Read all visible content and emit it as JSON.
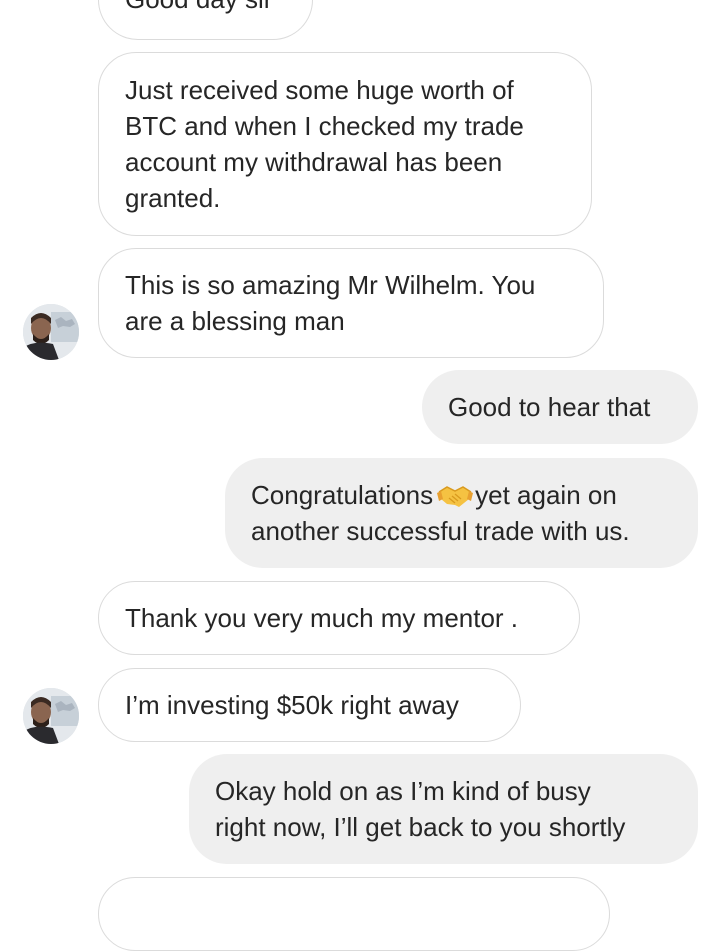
{
  "conversation": {
    "messages": [
      {
        "direction": "incoming",
        "lines": [
          "Good day sir"
        ]
      },
      {
        "direction": "incoming",
        "lines": [
          "Just received some huge worth of",
          "BTC and when I checked my trade",
          "account my withdrawal has been",
          "granted."
        ]
      },
      {
        "direction": "incoming",
        "lines": [
          "This is so amazing Mr Wilhelm. You",
          "are a blessing man"
        ]
      },
      {
        "direction": "outgoing",
        "lines": [
          "Good to hear that"
        ]
      },
      {
        "direction": "outgoing",
        "lines": [
          "Congratulations",
          "yet again on",
          "another successful trade with us."
        ]
      },
      {
        "direction": "incoming",
        "lines": [
          "Thank you very much my mentor ."
        ]
      },
      {
        "direction": "incoming",
        "lines": [
          "I’m investing $50k right away"
        ]
      },
      {
        "direction": "outgoing",
        "lines": [
          "Okay hold on as I’m kind of busy",
          "right now, I’ll get back to you shortly"
        ]
      },
      {
        "direction": "incoming",
        "lines": []
      }
    ],
    "icons": {
      "congrats_emoji": "handshake-icon",
      "sender_avatar": "avatar"
    }
  },
  "colors": {
    "incoming_bubble_bg": "#ffffff",
    "incoming_bubble_border": "#dbdbdb",
    "outgoing_bubble_bg": "#efefef",
    "text": "#262626"
  }
}
